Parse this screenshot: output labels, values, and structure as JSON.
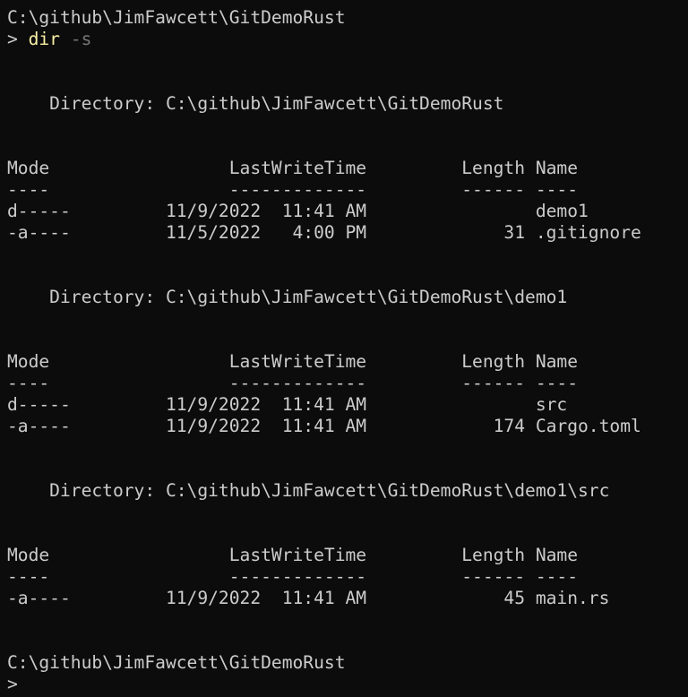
{
  "window": {
    "prompt_path": "C:\\github\\JimFawcett\\GitDemoRust",
    "prompt_symbol": "> ",
    "command": "dir",
    "command_args": "-s"
  },
  "listing": [
    {
      "directory_line": "    Directory: C:\\github\\JimFawcett\\GitDemoRust",
      "header": "Mode                 LastWriteTime         Length Name",
      "underline": "----                 -------------         ------ ----",
      "rows": [
        "d-----         11/9/2022  11:41 AM                demo1",
        "-a----         11/5/2022   4:00 PM             31 .gitignore"
      ]
    },
    {
      "directory_line": "    Directory: C:\\github\\JimFawcett\\GitDemoRust\\demo1",
      "header": "Mode                 LastWriteTime         Length Name",
      "underline": "----                 -------------         ------ ----",
      "rows": [
        "d-----         11/9/2022  11:41 AM                src",
        "-a----         11/9/2022  11:41 AM            174 Cargo.toml"
      ]
    },
    {
      "directory_line": "    Directory: C:\\github\\JimFawcett\\GitDemoRust\\demo1\\src",
      "header": "Mode                 LastWriteTime         Length Name",
      "underline": "----                 -------------         ------ ----",
      "rows": [
        "-a----         11/9/2022  11:41 AM             45 main.rs"
      ]
    }
  ],
  "final_prompt": {
    "path": "C:\\github\\JimFawcett\\GitDemoRust",
    "symbol": ">"
  },
  "colors": {
    "background": "#0c0c0c",
    "foreground": "#cccccc",
    "command": "#f9f1a5",
    "parameter": "#767676"
  }
}
